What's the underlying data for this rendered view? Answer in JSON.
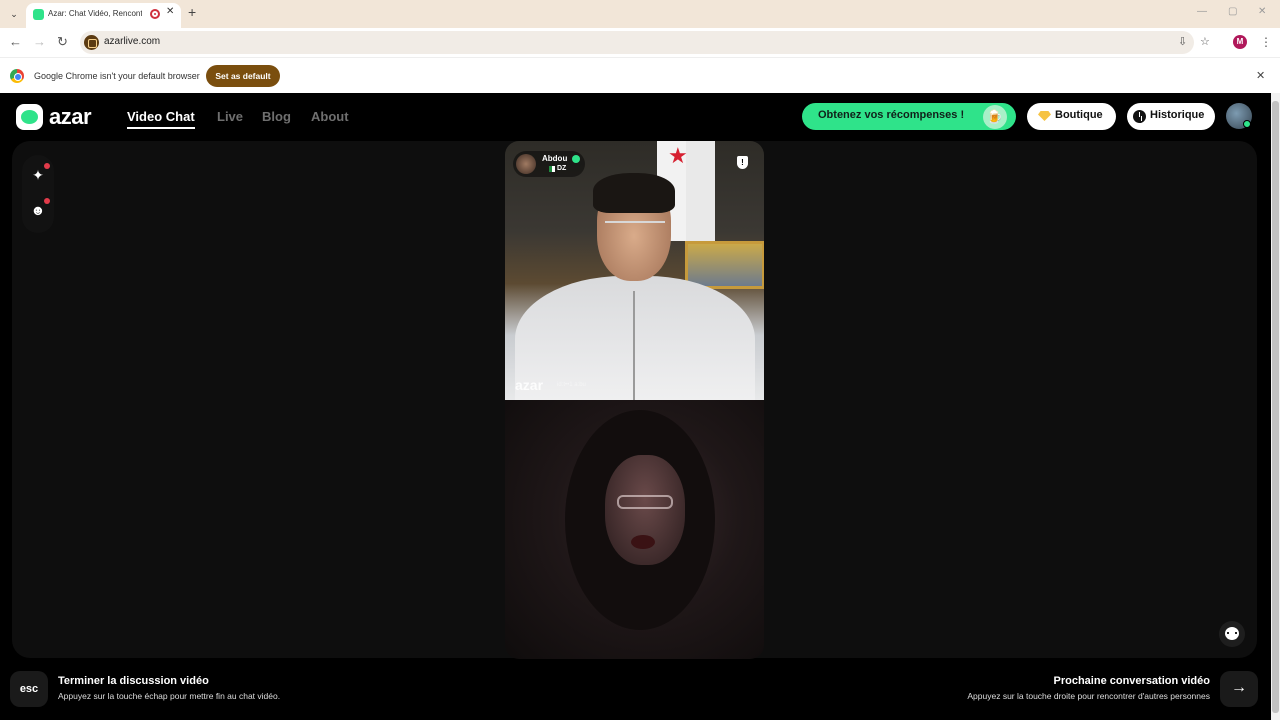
{
  "browser": {
    "tab": {
      "title": "Azar: Chat Vidéo, Rencontre",
      "close": "✕"
    },
    "new_tab": "+",
    "tab_menu": "⌄",
    "window": {
      "minimize": "—",
      "restore": "▢",
      "close": "✕"
    },
    "nav": {
      "back": "←",
      "forward": "→",
      "reload": "↻"
    },
    "url": "azarlive.com",
    "omnibox_icons": {
      "install": "⇩",
      "bookmark": "☆"
    },
    "profile_initial": "M",
    "menu": "⋮"
  },
  "infobar": {
    "message": "Google Chrome isn't your default browser",
    "button": "Set as default",
    "close": "✕"
  },
  "site": {
    "logo": "azar",
    "nav": [
      {
        "label": "Video Chat",
        "active": true
      },
      {
        "label": "Live",
        "active": false
      },
      {
        "label": "Blog",
        "active": false
      },
      {
        "label": "About",
        "active": false
      }
    ],
    "rewards_button": "Obtenez vos récompenses !",
    "shop_button": "Boutique",
    "history_button": "Historique",
    "accent_color": "#2fe38a"
  },
  "side_tools": {
    "effects": "✦",
    "stickers": "☻"
  },
  "remote": {
    "name": "Abdou",
    "country": "DZ",
    "report": "!",
    "watermark": "azar",
    "watermark_sub": "id:t••1 a:bu"
  },
  "controls": {
    "esc_key": "esc",
    "end_title": "Terminer la discussion vidéo",
    "end_subtitle": "Appuyez sur la touche échap pour mettre fin au chat vidéo.",
    "next_title": "Prochaine conversation vidéo",
    "next_subtitle": "Appuyez sur la touche droite pour rencontrer d'autres personnes",
    "next_key": "→"
  }
}
